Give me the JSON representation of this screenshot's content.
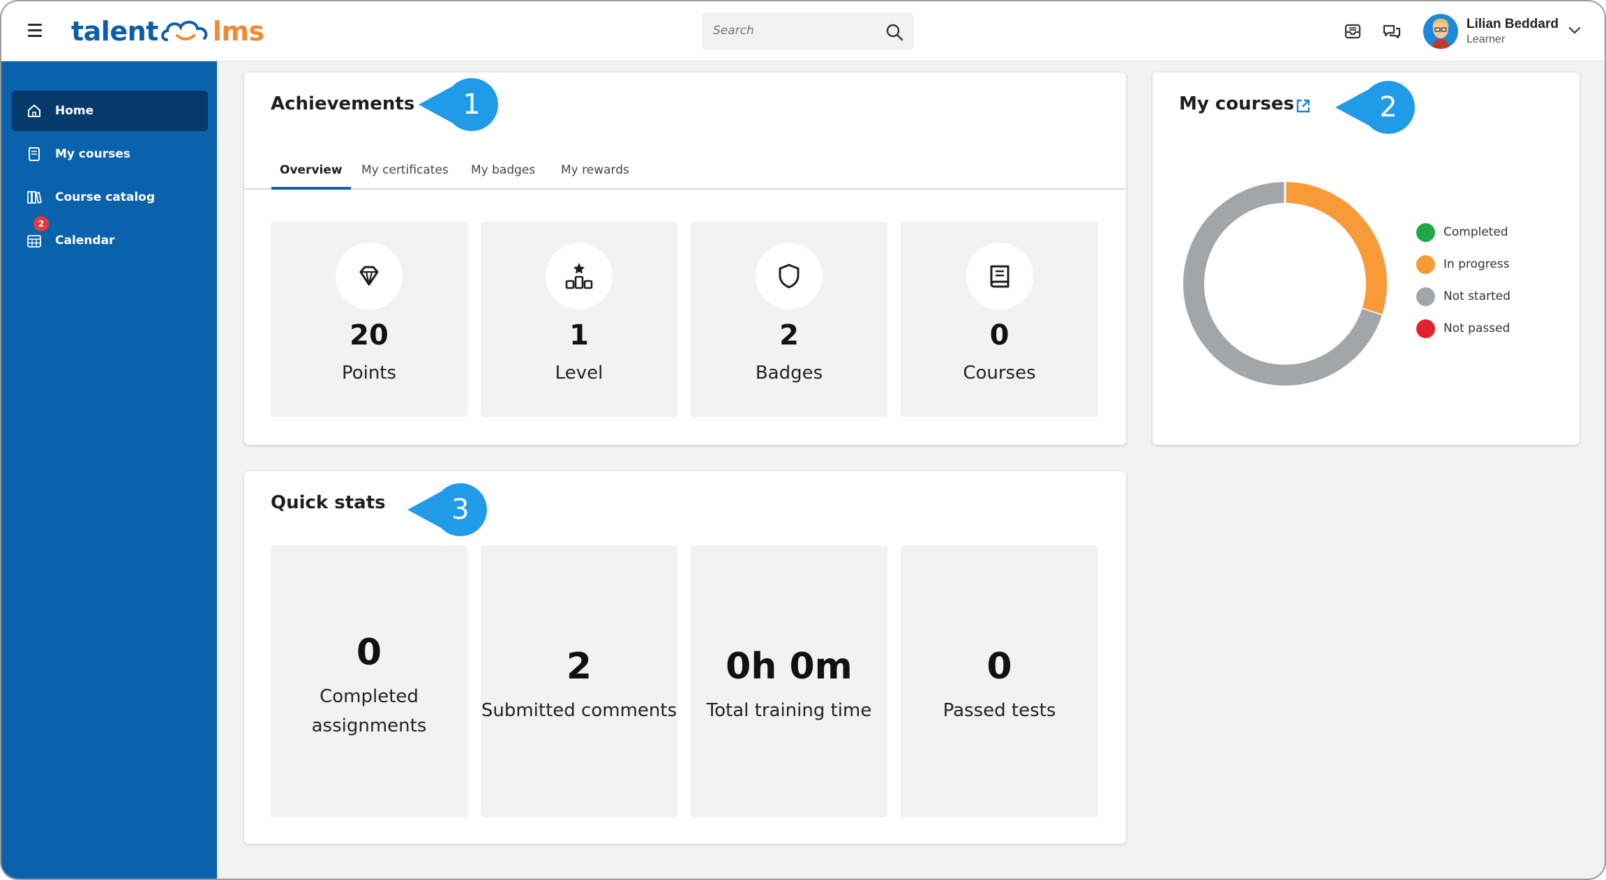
{
  "app": {
    "logo_left": "talent",
    "logo_right": "lms"
  },
  "search": {
    "placeholder": "Search"
  },
  "user": {
    "name": "Lilian Beddard",
    "role": "Learner"
  },
  "sidebar": {
    "items": [
      {
        "label": "Home",
        "icon": "home-icon",
        "active": true
      },
      {
        "label": "My courses",
        "icon": "book-icon"
      },
      {
        "label": "Course catalog",
        "icon": "catalog-icon"
      },
      {
        "label": "Calendar",
        "icon": "calendar-icon",
        "badge": "2"
      }
    ]
  },
  "achievements": {
    "title": "Achievements",
    "tabs": [
      "Overview",
      "My certificates",
      "My badges",
      "My rewards"
    ],
    "tiles": [
      {
        "value": "20",
        "label": "Points",
        "icon": "diamond-icon"
      },
      {
        "value": "1",
        "label": "Level",
        "icon": "podium-icon"
      },
      {
        "value": "2",
        "label": "Badges",
        "icon": "shield-icon"
      },
      {
        "value": "0",
        "label": "Courses",
        "icon": "book-icon"
      }
    ]
  },
  "my_courses": {
    "title": "My courses",
    "legend": [
      {
        "label": "Completed",
        "color": "#1fa84a"
      },
      {
        "label": "In progress",
        "color": "#f99a38"
      },
      {
        "label": "Not started",
        "color": "#a3a6a9"
      },
      {
        "label": "Not passed",
        "color": "#e3202d"
      }
    ]
  },
  "quick_stats": {
    "title": "Quick stats",
    "tiles": [
      {
        "value": "0",
        "label_line1": "Completed",
        "label_line2": "assignments"
      },
      {
        "value": "2",
        "label": "Submitted comments"
      },
      {
        "value": "0h 0m",
        "label": "Total training time"
      },
      {
        "value": "0",
        "label": "Passed tests"
      }
    ]
  },
  "callouts": [
    "1",
    "2",
    "3"
  ],
  "colors": {
    "sidebar": "#0a62ad",
    "sidebar_active": "#063a6b",
    "callout": "#1f9be8",
    "accent_orange": "#f28a2e"
  },
  "chart_data": {
    "type": "pie",
    "title": "",
    "categories": [
      "Completed",
      "In progress",
      "Not started",
      "Not passed"
    ],
    "values": [
      0,
      30,
      70,
      0
    ]
  }
}
